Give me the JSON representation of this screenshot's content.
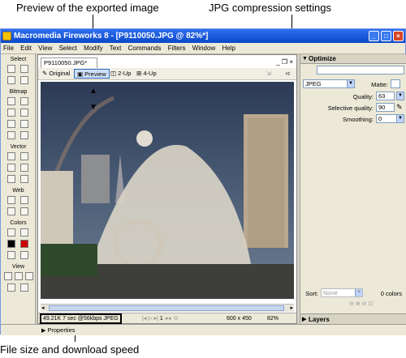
{
  "callouts": {
    "top_left": "Preview of the exported image",
    "top_right": "JPG compression settings",
    "bottom": "File size and download speed"
  },
  "window": {
    "title": "Macromedia Fireworks 8 - [P9110050.JPG @ 82%*]",
    "minimize": "_",
    "maximize": "□",
    "close": "×"
  },
  "menu": [
    "File",
    "Edit",
    "View",
    "Select",
    "Modify",
    "Text",
    "Commands",
    "Filters",
    "Window",
    "Help"
  ],
  "tools": {
    "select": "Select",
    "bitmap": "Bitmap",
    "vector": "Vector",
    "web": "Web",
    "colors": "Colors",
    "view": "View"
  },
  "document": {
    "tab": "P9110050.JPG*",
    "controls": "_ ❐ ×",
    "view_tabs": [
      "Original",
      "Preview",
      "2-Up",
      "4-Up"
    ],
    "status": {
      "info": "49.21K  7 sec @56kbps  JPEG",
      "frame": "1",
      "dimensions": "600 x 450",
      "zoom": "82%"
    }
  },
  "optimize": {
    "title": "Optimize",
    "preset": "",
    "format": "JPEG",
    "matte_label": "Matte:",
    "quality_label": "Quality:",
    "quality_value": "63",
    "selective_label": "Selective quality:",
    "selective_value": "90",
    "smoothing_label": "Smoothing:",
    "smoothing_value": "0",
    "sort_label": "Sort:",
    "sort_value": "None",
    "colors_count": "0 colors"
  },
  "layers": {
    "title": "Layers"
  },
  "properties": {
    "title": "Properties"
  }
}
